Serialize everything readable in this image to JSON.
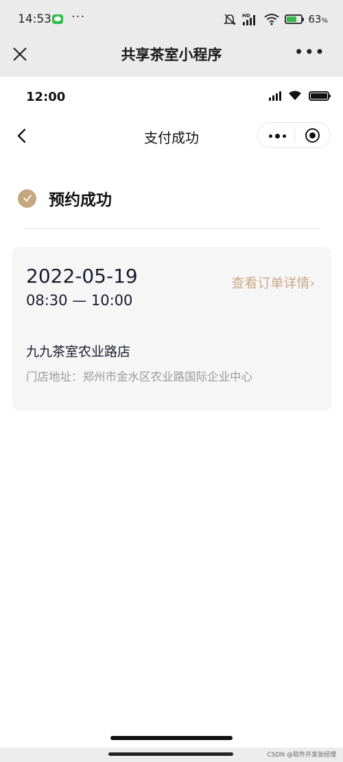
{
  "os_status": {
    "time": "14:53",
    "more": "···",
    "hd_label": "HD",
    "battery_percent": "63",
    "percent_sign": "%"
  },
  "miniprogram": {
    "title": "共享茶室小程序",
    "more": "•••"
  },
  "inner_status": {
    "time": "12:00"
  },
  "page": {
    "title": "支付成功"
  },
  "success": {
    "text": "预约成功"
  },
  "order": {
    "date": "2022-05-19",
    "time_range": "08:30 — 10:00",
    "detail_link": "查看订单详情",
    "detail_chevron": "›",
    "store_name": "九九茶室农业路店",
    "address_label": "门店地址：",
    "address": "郑州市金水区农业路国际企业中心"
  },
  "watermark": "CSDN @软件开发张经理",
  "colors": {
    "accent": "#c4a77d",
    "link": "#cba988",
    "card_bg": "#f6f6f6"
  },
  "icons": [
    "close-icon",
    "more-icon",
    "back-icon",
    "capsule-menu-icon",
    "capsule-close-icon",
    "check-icon",
    "wifi-icon",
    "signal-icon",
    "battery-icon",
    "mute-icon",
    "wechat-icon"
  ]
}
